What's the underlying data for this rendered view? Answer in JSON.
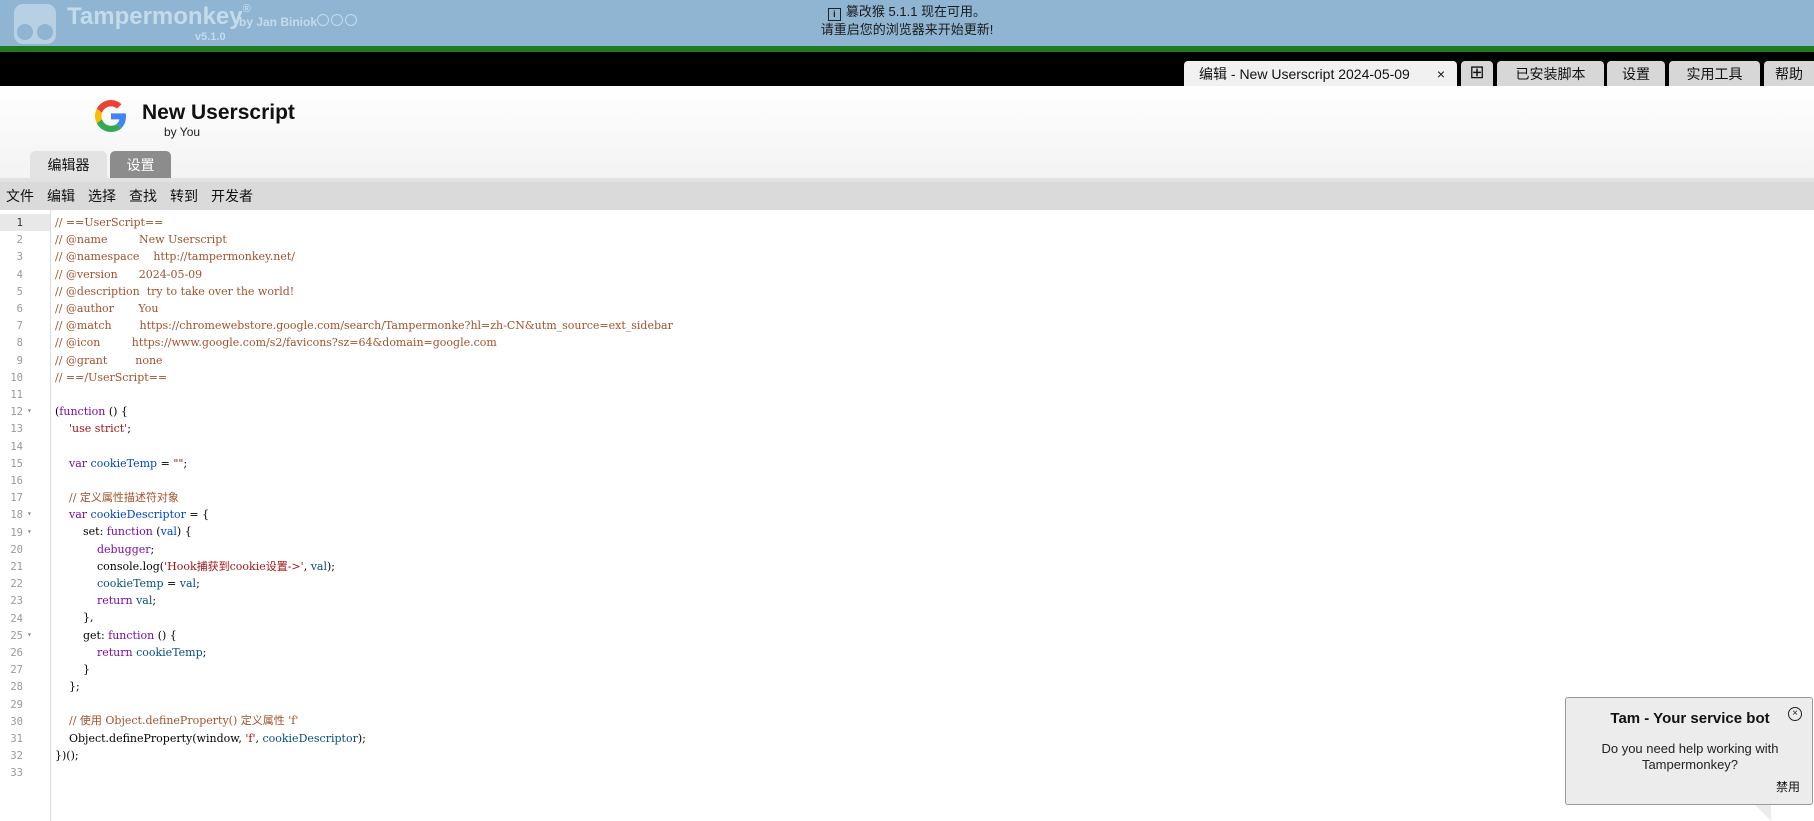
{
  "header": {
    "app_name": "Tampermonkey",
    "trademark": "®",
    "by_author": "by Jan Biniok",
    "version": "v5.1.0",
    "update_notice_line1": "篡改猴 5.1.1 现在可用。",
    "update_notice_line2": "请重启您的浏览器来开始更新!",
    "info_icon_glyph": "i",
    "social_icons": [
      "github-icon",
      "facebook-icon",
      "instagram-icon"
    ]
  },
  "tabs": {
    "edit_label": "编辑 - New Userscript 2024-05-09",
    "close_glyph": "×",
    "new_glyph": "⊞",
    "installed_label": "已安装脚本",
    "settings_label": "设置",
    "utilities_label": "实用工具",
    "help_label": "帮助"
  },
  "script": {
    "title": "New Userscript",
    "author": "by You"
  },
  "subtabs": {
    "editor": "编辑器",
    "settings": "设置"
  },
  "menu": [
    "文件",
    "编辑",
    "选择",
    "查找",
    "转到",
    "开发者"
  ],
  "editor": {
    "active_line": 1,
    "foldable_lines": [
      12,
      18,
      19,
      25
    ],
    "lines": [
      [
        [
          "// ==UserScript==",
          "comment"
        ]
      ],
      [
        [
          "// @name         New Userscript",
          "comment"
        ]
      ],
      [
        [
          "// @namespace    http://tampermonkey.net/",
          "comment"
        ]
      ],
      [
        [
          "// @version      2024-05-09",
          "comment"
        ]
      ],
      [
        [
          "// @description  try to take over the world!",
          "comment"
        ]
      ],
      [
        [
          "// @author       You",
          "comment"
        ]
      ],
      [
        [
          "// @match        https://chromewebstore.google.com/search/Tampermonke?hl=zh-CN&utm_source=ext_sidebar",
          "comment"
        ]
      ],
      [
        [
          "// @icon         https://www.google.com/s2/favicons?sz=64&domain=google.com",
          "comment"
        ]
      ],
      [
        [
          "// @grant        none",
          "comment"
        ]
      ],
      [
        [
          "// ==/UserScript==",
          "comment"
        ]
      ],
      [],
      [
        [
          "(",
          "plain"
        ],
        [
          "function",
          "kw"
        ],
        [
          " () {",
          "plain"
        ]
      ],
      [
        [
          "    ",
          "plain"
        ],
        [
          "'use strict'",
          "str"
        ],
        [
          ";",
          "plain"
        ]
      ],
      [],
      [
        [
          "    ",
          "plain"
        ],
        [
          "var",
          "kw"
        ],
        [
          " ",
          "plain"
        ],
        [
          "cookieTemp",
          "def"
        ],
        [
          " = ",
          "plain"
        ],
        [
          "\"\"",
          "str"
        ],
        [
          ";",
          "plain"
        ]
      ],
      [],
      [
        [
          "    // 定义属性描述符对象",
          "comment"
        ]
      ],
      [
        [
          "    ",
          "plain"
        ],
        [
          "var",
          "kw"
        ],
        [
          " ",
          "plain"
        ],
        [
          "cookieDescriptor",
          "def"
        ],
        [
          " = {",
          "plain"
        ]
      ],
      [
        [
          "        set",
          "key"
        ],
        [
          ": ",
          "plain"
        ],
        [
          "function",
          "kw"
        ],
        [
          " (",
          "plain"
        ],
        [
          "val",
          "def"
        ],
        [
          ") {",
          "plain"
        ]
      ],
      [
        [
          "            ",
          "plain"
        ],
        [
          "debugger",
          "kw"
        ],
        [
          ";",
          "plain"
        ]
      ],
      [
        [
          "            console.log(",
          "plain"
        ],
        [
          "'Hook捕获到cookie设置->'",
          "str"
        ],
        [
          ", ",
          "plain"
        ],
        [
          "val",
          "var"
        ],
        [
          ");",
          "plain"
        ]
      ],
      [
        [
          "            ",
          "plain"
        ],
        [
          "cookieTemp",
          "var"
        ],
        [
          " = ",
          "plain"
        ],
        [
          "val",
          "var"
        ],
        [
          ";",
          "plain"
        ]
      ],
      [
        [
          "            ",
          "plain"
        ],
        [
          "return",
          "kw"
        ],
        [
          " ",
          "plain"
        ],
        [
          "val",
          "var"
        ],
        [
          ";",
          "plain"
        ]
      ],
      [
        [
          "        },",
          "plain"
        ]
      ],
      [
        [
          "        get",
          "key"
        ],
        [
          ": ",
          "plain"
        ],
        [
          "function",
          "kw"
        ],
        [
          " () {",
          "plain"
        ]
      ],
      [
        [
          "            ",
          "plain"
        ],
        [
          "return",
          "kw"
        ],
        [
          " ",
          "plain"
        ],
        [
          "cookieTemp",
          "var"
        ],
        [
          ";",
          "plain"
        ]
      ],
      [
        [
          "        }",
          "plain"
        ]
      ],
      [
        [
          "    };",
          "plain"
        ]
      ],
      [],
      [
        [
          "    // 使用 Object.defineProperty() 定义属性 'f'",
          "comment"
        ]
      ],
      [
        [
          "    Object.defineProperty(window, ",
          "plain"
        ],
        [
          "'f'",
          "str"
        ],
        [
          ", ",
          "plain"
        ],
        [
          "cookieDescriptor",
          "var"
        ],
        [
          ");",
          "plain"
        ]
      ],
      [
        [
          "})();",
          "plain"
        ]
      ],
      []
    ]
  },
  "bot": {
    "title": "Tam - Your service bot",
    "message": "Do you need help working with Tampermonkey?",
    "disable_label": "禁用",
    "close_glyph": "×"
  },
  "colors": {
    "header_bg": "#8fb5d3",
    "green_strip": "#1f7a1f",
    "comment": "#a0522d",
    "keyword": "#7a0da0",
    "string": "#a31515",
    "definition": "#0044cc"
  }
}
